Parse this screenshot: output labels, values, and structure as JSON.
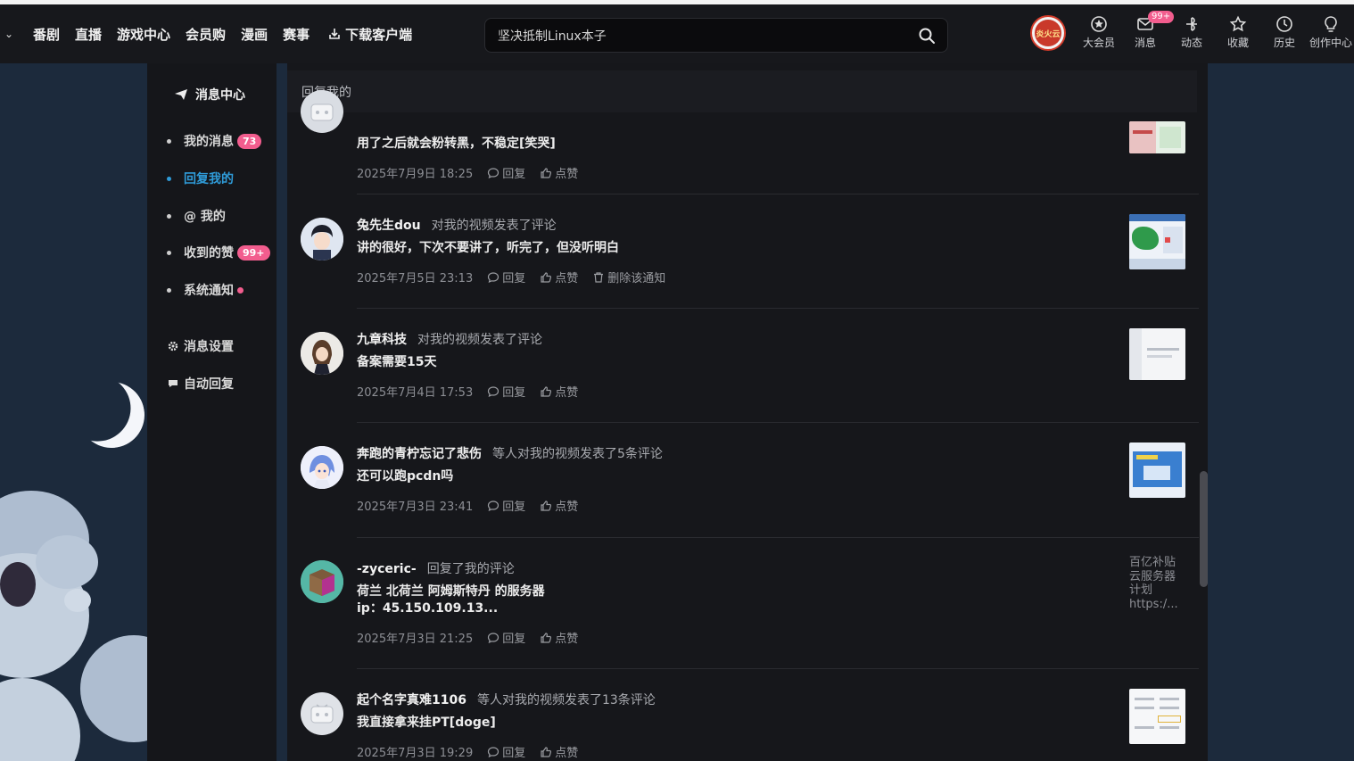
{
  "header": {
    "nav_items": [
      "番剧",
      "直播",
      "游戏中心",
      "会员购",
      "漫画",
      "赛事"
    ],
    "download_label": "下载客户端",
    "search_placeholder": "坚决抵制Linux本子",
    "avatar_text": "炎火云",
    "icons": [
      {
        "name": "vip-icon",
        "label": "大会员"
      },
      {
        "name": "message-icon",
        "label": "消息",
        "badge": "99+"
      },
      {
        "name": "dynamic-icon",
        "label": "动态"
      },
      {
        "name": "favorite-icon",
        "label": "收藏"
      },
      {
        "name": "history-icon",
        "label": "历史"
      },
      {
        "name": "creator-icon",
        "label": "创作中心"
      }
    ]
  },
  "sidebar": {
    "title": "消息中心",
    "items": [
      {
        "label": "我的消息",
        "count": "73"
      },
      {
        "label": "回复我的",
        "active": true
      },
      {
        "label": "@ 我的"
      },
      {
        "label": "收到的赞",
        "count": "99+"
      },
      {
        "label": "系统通知",
        "dot": true
      }
    ],
    "settings": [
      {
        "label": "消息设置",
        "icon": "gear-icon"
      },
      {
        "label": "自动回复",
        "icon": "chat-bubble-icon"
      }
    ]
  },
  "main": {
    "title": "回复我的",
    "reply_label": "回复",
    "like_label": "点赞",
    "delete_label": "删除该通知",
    "items": [
      {
        "user": "",
        "action": "",
        "content": "用了之后就会粉转黑，不稳定[笑哭]",
        "time": "2025年7月9日 18:25"
      },
      {
        "user": "兔先生dou",
        "action": "对我的视频发表了评论",
        "content": "讲的很好，下次不要讲了，听完了，但没听明白",
        "time": "2025年7月5日 23:13",
        "hover": true
      },
      {
        "user": "九章科技",
        "action": "对我的视频发表了评论",
        "content": "备案需要15天",
        "time": "2025年7月4日 17:53"
      },
      {
        "user": "奔跑的青柠忘记了悲伤",
        "action": "等人对我的视频发表了5条评论",
        "content": "还可以跑pcdn吗",
        "time": "2025年7月3日 23:41"
      },
      {
        "user": "-zyceric-",
        "action": "回复了我的评论",
        "content": "荷兰 北荷兰 阿姆斯特丹 的服务器",
        "content2": "ip：45.150.109.13...",
        "time": "2025年7月3日 21:25",
        "thumb_text": [
          "百亿补贴",
          "云服务器",
          "计划",
          "https:/..."
        ]
      },
      {
        "user": "起个名字真难1106",
        "action": "等人对我的视频发表了13条评论",
        "content": "我直接拿来挂PT[doge]",
        "time": "2025年7月3日 19:29"
      }
    ]
  }
}
